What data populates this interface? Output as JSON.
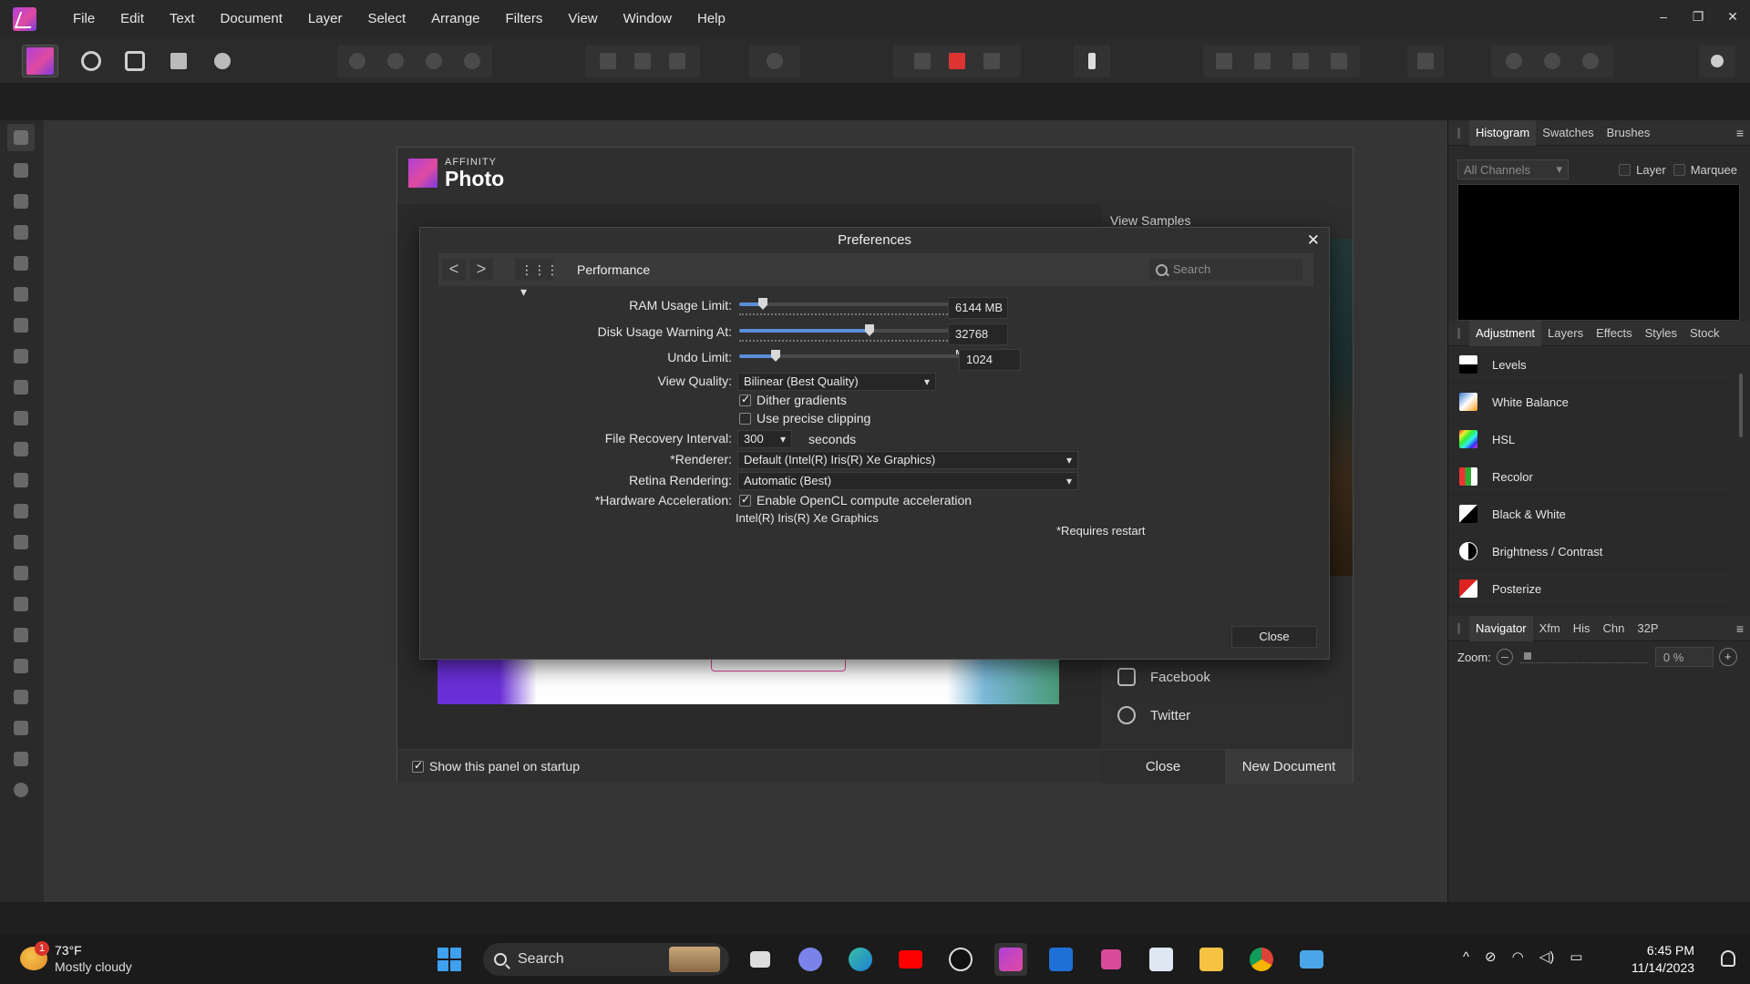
{
  "menubar": {
    "items": [
      "File",
      "Edit",
      "Text",
      "Document",
      "Layer",
      "Select",
      "Arrange",
      "Filters",
      "View",
      "Window",
      "Help"
    ]
  },
  "window_controls": {
    "minimize": "–",
    "restore": "❐",
    "close": "✕"
  },
  "right_panel": {
    "top_tabs": [
      "Histogram",
      "Swatches",
      "Brushes"
    ],
    "channels_select": "All Channels",
    "layer_label": "Layer",
    "marquee_label": "Marquee",
    "mid_tabs": [
      "Adjustment",
      "Layers",
      "Effects",
      "Styles",
      "Stock"
    ],
    "adjustments": [
      "Levels",
      "White Balance",
      "HSL",
      "Recolor",
      "Black & White",
      "Brightness / Contrast",
      "Posterize"
    ],
    "bottom_tabs": [
      "Navigator",
      "Xfm",
      "His",
      "Chn",
      "32P"
    ],
    "zoom_label": "Zoom:",
    "zoom_value": "0 %",
    "zoom_plus": "+"
  },
  "welcome": {
    "brand_small": "AFFINITY",
    "brand_large": "Photo",
    "view_samples": "View Samples",
    "social": [
      "Facebook",
      "Twitter"
    ],
    "show_on_startup": "Show this panel on startup",
    "close_label": "Close",
    "new_document_label": "New Document"
  },
  "preferences": {
    "title": "Preferences",
    "close_x": "✕",
    "back": "<",
    "forward": ">",
    "grid_icon": "⋮⋮⋮ ▾",
    "section": "Performance",
    "search_placeholder": "Search",
    "ram_label": "RAM Usage Limit:",
    "ram_value": "6144 MB",
    "ram_fraction": 0.09,
    "disk_label": "Disk Usage Warning At:",
    "disk_value": "32768 MB",
    "disk_fraction": 0.49,
    "undo_label": "Undo Limit:",
    "undo_value": "1024",
    "undo_fraction": 0.13,
    "view_quality_label": "View Quality:",
    "view_quality_value": "Bilinear (Best Quality)",
    "dither_label": "Dither gradients",
    "dither_checked": true,
    "precise_clip_label": "Use precise clipping",
    "precise_clip_checked": false,
    "file_recovery_label": "File Recovery Interval:",
    "file_recovery_value": "300",
    "file_recovery_unit": "seconds",
    "renderer_label": "*Renderer:",
    "renderer_value": "Default (Intel(R) Iris(R) Xe Graphics)",
    "retina_label": "Retina Rendering:",
    "retina_value": "Automatic (Best)",
    "hw_label": "*Hardware Acceleration:",
    "hw_option_label": "Enable OpenCL compute acceleration",
    "hw_checked": true,
    "hw_device": "Intel(R) Iris(R) Xe Graphics",
    "requires_restart": "*Requires restart",
    "close_label": "Close"
  },
  "taskbar": {
    "weather_badge": "1",
    "weather_temp": "73°F",
    "weather_desc": "Mostly cloudy",
    "search_label": "Search",
    "time": "6:45 PM",
    "date": "11/14/2023",
    "tray_chevron": "^"
  },
  "colors": {
    "accent_blue": "#5a8ed8",
    "affinity_purple": "#b040d8"
  }
}
